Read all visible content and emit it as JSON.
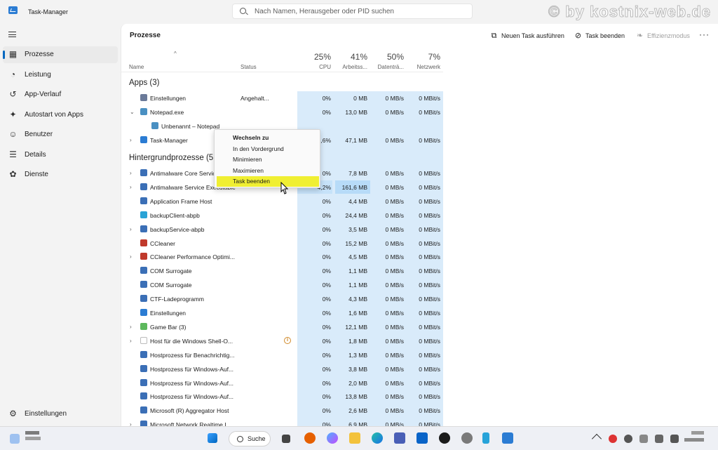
{
  "window": {
    "title": "Task-Manager",
    "search_placeholder": "Nach Namen, Herausgeber oder PID suchen",
    "watermark": "© by kostnix-web.de"
  },
  "sidebar": {
    "items": [
      {
        "label": "Prozesse",
        "icon": "grid-icon",
        "active": true
      },
      {
        "label": "Leistung",
        "icon": "performance-icon"
      },
      {
        "label": "App-Verlauf",
        "icon": "history-icon"
      },
      {
        "label": "Autostart von Apps",
        "icon": "startup-icon"
      },
      {
        "label": "Benutzer",
        "icon": "users-icon"
      },
      {
        "label": "Details",
        "icon": "list-icon"
      },
      {
        "label": "Dienste",
        "icon": "services-icon"
      }
    ],
    "settings_label": "Einstellungen"
  },
  "toolbar": {
    "page_title": "Prozesse",
    "run_task": "Neuen Task ausführen",
    "end_task": "Task beenden",
    "efficiency": "Effizienzmodus",
    "more": "···"
  },
  "columns": {
    "name": "Name",
    "status": "Status",
    "cpu_pct": "25%",
    "cpu": "CPU",
    "mem_pct": "41%",
    "mem": "Arbeitss...",
    "disk_pct": "50%",
    "disk": "Datenträ...",
    "net_pct": "7%",
    "net": "Netzwerk"
  },
  "sections": {
    "apps": "Apps (3)",
    "background": "Hintergrundprozesse (51)"
  },
  "apps": [
    {
      "name": "Einstellungen",
      "status": "Angehalt...",
      "cpu": "0%",
      "mem": "0 MB",
      "disk": "0 MB/s",
      "net": "0 MBit/s",
      "chev": "",
      "color": "#6b7a99"
    },
    {
      "name": "Notepad.exe",
      "status": "",
      "cpu": "0%",
      "mem": "13,0 MB",
      "disk": "0 MB/s",
      "net": "0 MBit/s",
      "chev": "⌄",
      "color": "#4a90c2"
    },
    {
      "name": "Unbenannt – Notepad",
      "status": "",
      "cpu": "",
      "mem": "",
      "disk": "",
      "net": "",
      "chev": "",
      "color": "#4a90c2",
      "child": true
    },
    {
      "name": "Task-Manager",
      "status": "",
      "cpu": "1,6%",
      "mem": "47,1 MB",
      "disk": "0 MB/s",
      "net": "0 MBit/s",
      "chev": "›",
      "color": "#2b7cd3"
    }
  ],
  "background": [
    {
      "name": "Antimalware Core Service",
      "cpu": "0%",
      "mem": "7,8 MB",
      "disk": "0 MB/s",
      "net": "0 MBit/s",
      "chev": "›",
      "color": "#3b6fb6",
      "status": ""
    },
    {
      "name": "Antimalware Service Executable",
      "cpu": "4,2%",
      "mem": "161,6 MB",
      "disk": "0 MB/s",
      "net": "0 MBit/s",
      "chev": "›",
      "color": "#3b6fb6",
      "status": ""
    },
    {
      "name": "Application Frame Host",
      "cpu": "0%",
      "mem": "4,4 MB",
      "disk": "0 MB/s",
      "net": "0 MBit/s",
      "chev": "",
      "color": "#3b6fb6",
      "status": ""
    },
    {
      "name": "backupClient-abpb",
      "cpu": "0%",
      "mem": "24,4 MB",
      "disk": "0 MB/s",
      "net": "0 MBit/s",
      "chev": "",
      "color": "#2aa3d6",
      "status": ""
    },
    {
      "name": "backupService-abpb",
      "cpu": "0%",
      "mem": "3,5 MB",
      "disk": "0 MB/s",
      "net": "0 MBit/s",
      "chev": "›",
      "color": "#3b6fb6",
      "status": ""
    },
    {
      "name": "CCleaner",
      "cpu": "0%",
      "mem": "15,2 MB",
      "disk": "0 MB/s",
      "net": "0 MBit/s",
      "chev": "",
      "color": "#c0392b",
      "status": ""
    },
    {
      "name": "CCleaner Performance Optimi...",
      "cpu": "0%",
      "mem": "4,5 MB",
      "disk": "0 MB/s",
      "net": "0 MBit/s",
      "chev": "›",
      "color": "#c0392b",
      "status": ""
    },
    {
      "name": "COM Surrogate",
      "cpu": "0%",
      "mem": "1,1 MB",
      "disk": "0 MB/s",
      "net": "0 MBit/s",
      "chev": "",
      "color": "#3b6fb6",
      "status": ""
    },
    {
      "name": "COM Surrogate",
      "cpu": "0%",
      "mem": "1,1 MB",
      "disk": "0 MB/s",
      "net": "0 MBit/s",
      "chev": "",
      "color": "#3b6fb6",
      "status": ""
    },
    {
      "name": "CTF-Ladeprogramm",
      "cpu": "0%",
      "mem": "4,3 MB",
      "disk": "0 MB/s",
      "net": "0 MBit/s",
      "chev": "",
      "color": "#3b6fb6",
      "status": ""
    },
    {
      "name": "Einstellungen",
      "cpu": "0%",
      "mem": "1,6 MB",
      "disk": "0 MB/s",
      "net": "0 MBit/s",
      "chev": "",
      "color": "#2b7cd3",
      "status": ""
    },
    {
      "name": "Game Bar (3)",
      "cpu": "0%",
      "mem": "12,1 MB",
      "disk": "0 MB/s",
      "net": "0 MBit/s",
      "chev": "›",
      "color": "#5cb85c",
      "status": ""
    },
    {
      "name": "Host für die Windows Shell-O...",
      "cpu": "0%",
      "mem": "1,8 MB",
      "disk": "0 MB/s",
      "net": "0 MBit/s",
      "chev": "›",
      "color": "#ffffff",
      "status": "",
      "paused": true
    },
    {
      "name": "Hostprozess für Benachrichtig...",
      "cpu": "0%",
      "mem": "1,3 MB",
      "disk": "0 MB/s",
      "net": "0 MBit/s",
      "chev": "",
      "color": "#3b6fb6",
      "status": ""
    },
    {
      "name": "Hostprozess für Windows-Auf...",
      "cpu": "0%",
      "mem": "3,8 MB",
      "disk": "0 MB/s",
      "net": "0 MBit/s",
      "chev": "",
      "color": "#3b6fb6",
      "status": ""
    },
    {
      "name": "Hostprozess für Windows-Auf...",
      "cpu": "0%",
      "mem": "2,0 MB",
      "disk": "0 MB/s",
      "net": "0 MBit/s",
      "chev": "",
      "color": "#3b6fb6",
      "status": ""
    },
    {
      "name": "Hostprozess für Windows-Auf...",
      "cpu": "0%",
      "mem": "13,8 MB",
      "disk": "0 MB/s",
      "net": "0 MBit/s",
      "chev": "",
      "color": "#3b6fb6",
      "status": ""
    },
    {
      "name": "Microsoft (R) Aggregator Host",
      "cpu": "0%",
      "mem": "2,6 MB",
      "disk": "0 MB/s",
      "net": "0 MBit/s",
      "chev": "",
      "color": "#3b6fb6",
      "status": ""
    },
    {
      "name": "Microsoft Network Realtime I...",
      "cpu": "0%",
      "mem": "6,9 MB",
      "disk": "0 MB/s",
      "net": "0 MBit/s",
      "chev": "›",
      "color": "#3b6fb6",
      "status": ""
    }
  ],
  "context_menu": {
    "items": [
      {
        "label": "Wechseln zu",
        "bold": true
      },
      {
        "label": "In den Vordergrund"
      },
      {
        "label": "Minimieren"
      },
      {
        "label": "Maximieren"
      },
      {
        "label": "Task beenden",
        "highlighted": true
      }
    ]
  },
  "taskbar": {
    "search_label": "Suche"
  },
  "colors": {
    "accent": "#0067c0",
    "highlight": "#f0ef32",
    "column_shade": "#d9ebfa"
  }
}
